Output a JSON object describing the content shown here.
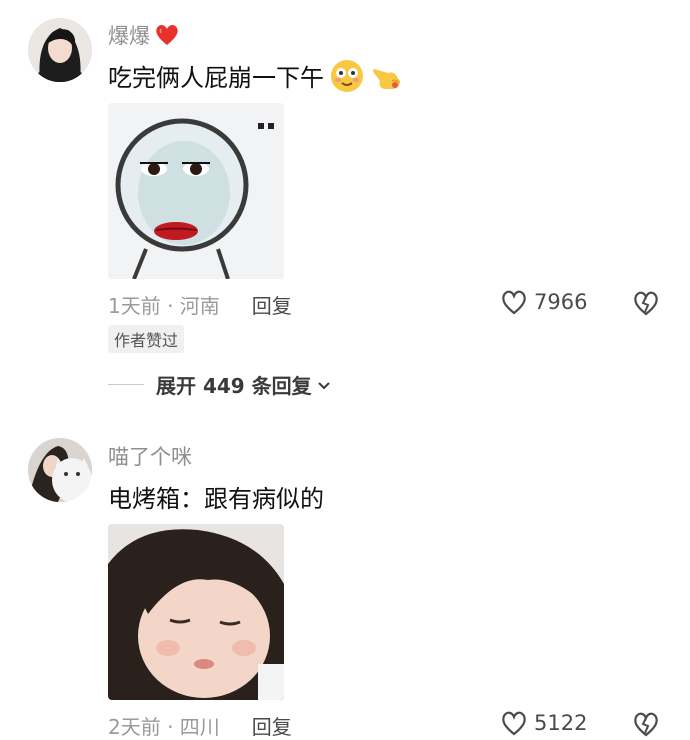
{
  "comments": [
    {
      "username": "爆爆",
      "text": "吃完俩人屁崩一下午",
      "time_location": "1天前 · 河南",
      "reply_label": "回复",
      "like_count": "7966",
      "author_badge": "作者赞过",
      "expand_label": "展开 449 条回复",
      "icons": {
        "name_emoji": "red-heart-icon",
        "emoji_1": "smiley-flushed-icon",
        "emoji_2": "pointing-hand-icon"
      }
    },
    {
      "username": "喵了个咪",
      "text": "电烤箱：跟有病似的",
      "time_location": "2天前 · 四川",
      "reply_label": "回复",
      "like_count": "5122"
    }
  ],
  "colors": {
    "username": "#8f8f8f",
    "meta": "#9a9a9a",
    "accent_heart": "#e8302d"
  }
}
